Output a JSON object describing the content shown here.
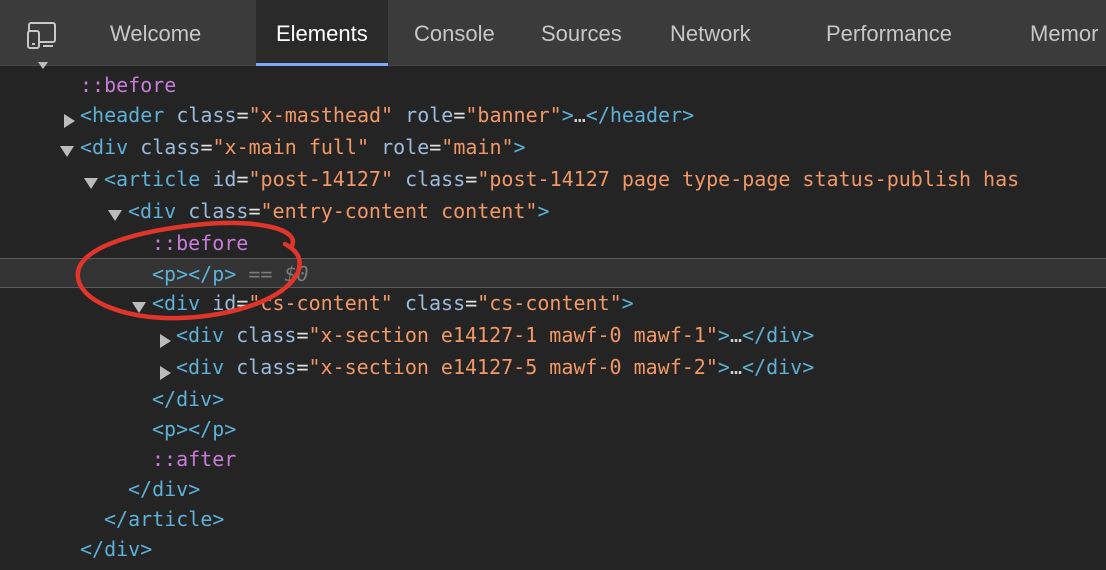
{
  "tabs": [
    {
      "label": "Welcome",
      "active": false
    },
    {
      "label": "Elements",
      "active": true
    },
    {
      "label": "Console",
      "active": false
    },
    {
      "label": "Sources",
      "active": false
    },
    {
      "label": "Network",
      "active": false
    },
    {
      "label": "Performance",
      "active": false
    },
    {
      "label": "Memor",
      "active": false
    }
  ],
  "colors": {
    "tag": "#5db0d7",
    "attr_name": "#9bbbdc",
    "attr_value": "#f29766",
    "pseudo": "#c97bdb",
    "annotation_circle": "#e0352b",
    "active_tab_underline": "#7cacf8"
  },
  "icons": {
    "device_toolbar": "device-mode-icon"
  },
  "tree": {
    "l0_pseudo": "::before",
    "l1_open": "<header",
    "l1_attr1": "class",
    "l1_val1": "\"x-masthead\"",
    "l1_attr2": "role",
    "l1_val2": "\"banner\"",
    "l1_gt": ">",
    "l1_ellipsis": "…",
    "l1_close": "</header>",
    "l2_open": "<div",
    "l2_attr1": "class",
    "l2_val1": "\"x-main full\"",
    "l2_attr2": "role",
    "l2_val2": "\"main\"",
    "l2_gt": ">",
    "l3_open": "<article",
    "l3_attr1": "id",
    "l3_val1": "\"post-14127\"",
    "l3_attr2": "class",
    "l3_val2": "\"post-14127 page type-page status-publish has",
    "l4_open": "<div",
    "l4_attr1": "class",
    "l4_val1": "\"entry-content content\"",
    "l4_gt": ">",
    "l5_pseudo": "::before",
    "l6_p": "<p></p>",
    "l6_marker": "== $0",
    "l7_open": "<div",
    "l7_attr1": "id",
    "l7_val1": "\"cs-content\"",
    "l7_attr2": "class",
    "l7_val2": "\"cs-content\"",
    "l7_gt": ">",
    "l8_open": "<div",
    "l8_attr1": "class",
    "l8_val1": "\"x-section e14127-1 mawf-0 mawf-1\"",
    "l8_gt": ">",
    "l8_ellipsis": "…",
    "l8_close": "</div>",
    "l9_open": "<div",
    "l9_attr1": "class",
    "l9_val1": "\"x-section e14127-5 mawf-0 mawf-2\"",
    "l9_gt": ">",
    "l9_ellipsis": "…",
    "l9_close": "</div>",
    "l10_close": "</div>",
    "l11_p": "<p></p>",
    "l12_pseudo": "::after",
    "l13_close": "</div>",
    "l14_close": "</article>",
    "l15_close": "</div>",
    "eq": "="
  }
}
